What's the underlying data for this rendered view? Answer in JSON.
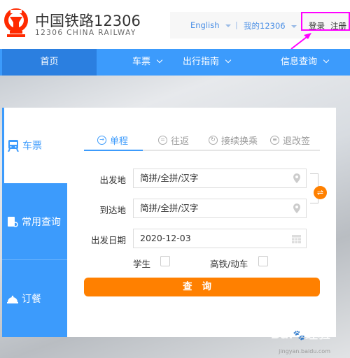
{
  "header": {
    "brand": "中国铁路12306",
    "brand_en": "12306 CHINA RAILWAY",
    "language": "English",
    "my_account": "我的12306",
    "login": "登录",
    "register": "注册",
    "brand_color": "#ff2a00"
  },
  "nav": {
    "items": [
      {
        "label": "首页"
      },
      {
        "label": "车票"
      },
      {
        "label": "出行指南"
      },
      {
        "label": "信息查询"
      }
    ],
    "color": "#3c9bfc"
  },
  "sidebar": {
    "items": [
      {
        "label": "车票",
        "icon": "train-icon"
      },
      {
        "label": "常用查询",
        "icon": "search-doc-icon"
      },
      {
        "label": "订餐",
        "icon": "food-bell-icon"
      }
    ]
  },
  "tabs": [
    {
      "label": "单程",
      "icon": "→"
    },
    {
      "label": "往返",
      "icon": "="
    },
    {
      "label": "接续换乘",
      "icon": "↻"
    },
    {
      "label": "退改签",
      "icon": "≡"
    }
  ],
  "form": {
    "from_label": "出发地",
    "from_placeholder": "简拼/全拼/汉字",
    "to_label": "到达地",
    "to_placeholder": "简拼/全拼/汉字",
    "date_label": "出发日期",
    "date_value": "2020-12-03",
    "student_label": "学生",
    "student_checked": false,
    "gaotie_label": "高铁/动车",
    "gaotie_checked": false,
    "submit": "查询",
    "swap_icon": "⇌",
    "accent": "#ff8000"
  },
  "watermark": {
    "logo": "Baidu经验",
    "url": "jingyan.baidu.com"
  }
}
